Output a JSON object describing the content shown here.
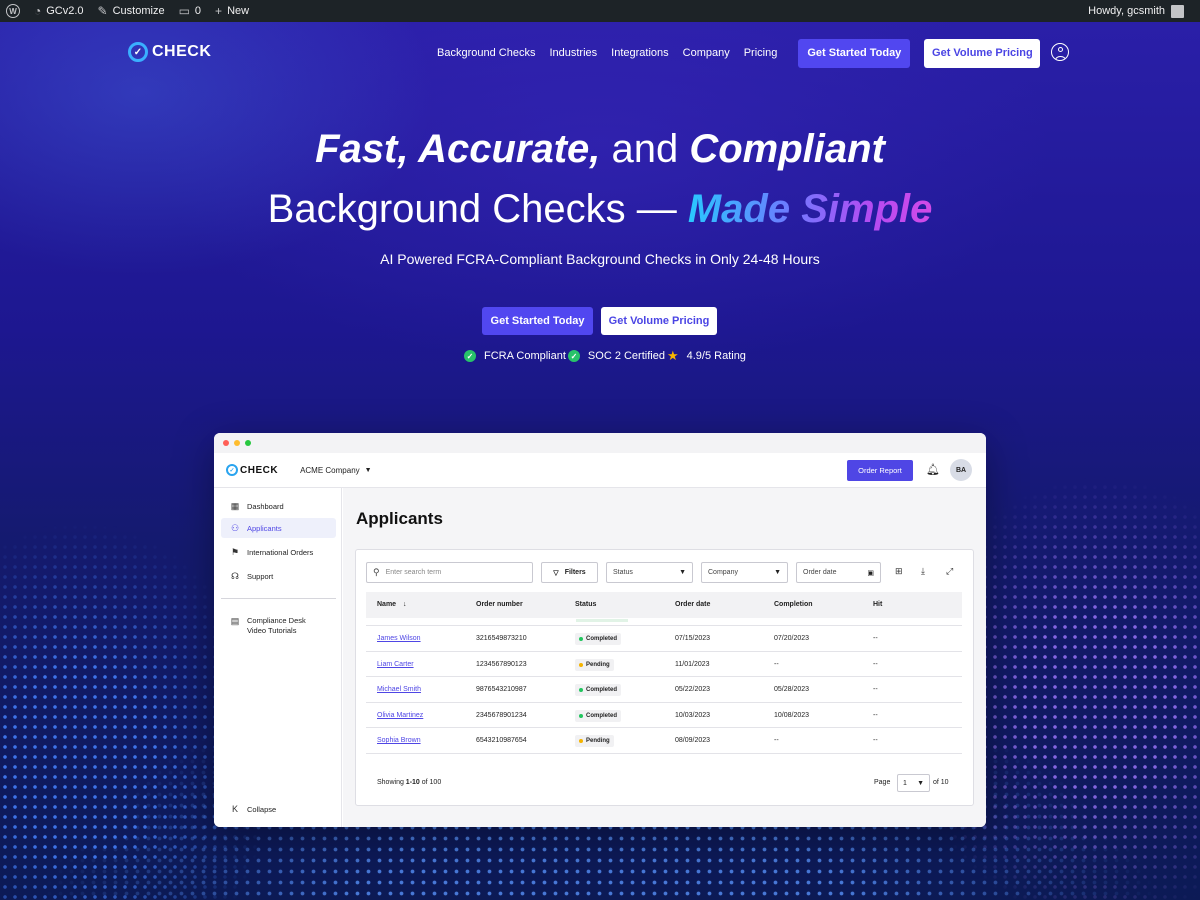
{
  "admin_bar": {
    "site_name": "GCv2.0",
    "customize": "Customize",
    "comments_count": "0",
    "new_label": "New",
    "greeting": "Howdy, gcsmith"
  },
  "brand": {
    "logo_text": "CHECK",
    "accent_color": "#5147f0",
    "logo_color": "#3ab0ff"
  },
  "nav": {
    "links": [
      "Background Checks",
      "Industries",
      "Integrations",
      "Company",
      "Pricing"
    ],
    "primary_cta": "Get Started Today",
    "secondary_cta": "Get Volume Pricing"
  },
  "hero": {
    "line1_a": "Fast, Accurate,",
    "line1_b": " and ",
    "line1_c": "Compliant",
    "line2_a": "Background Checks — ",
    "line2_b": "Made Simple",
    "subhead": "AI Powered FCRA-Compliant Background Checks in Only 24-48 Hours",
    "primary_cta": "Get Started Today",
    "secondary_cta": "Get Volume Pricing",
    "badges": [
      "FCRA Compliant",
      "SOC 2 Certified",
      "4.9/5 Rating"
    ]
  },
  "app": {
    "logo_text": "CHECK",
    "company_selector": "ACME Company",
    "order_button": "Order Report",
    "user_initials": "BA",
    "sidebar": {
      "items": [
        {
          "label": "Dashboard",
          "icon": "grid-icon"
        },
        {
          "label": "Applicants",
          "icon": "users-icon"
        },
        {
          "label": "International Orders",
          "icon": "flag-icon"
        },
        {
          "label": "Support",
          "icon": "headset-icon"
        }
      ],
      "compliance_label_1": "Compliance Desk",
      "compliance_label_2": "Video Tutorials",
      "collapse_label": "Collapse"
    },
    "page_title": "Applicants",
    "toolbar": {
      "search_placeholder": "Enter search term",
      "filters_label": "Filters",
      "status_select": "Status",
      "company_select": "Company",
      "order_date_select": "Order date"
    },
    "table": {
      "columns": [
        "Name",
        "Order number",
        "Status",
        "Order date",
        "Completion",
        "Hit"
      ],
      "rows": [
        {
          "name": "James Wilson",
          "order": "3216549873210",
          "status": "Completed",
          "order_date": "07/15/2023",
          "completion": "07/20/2023",
          "hit": "--"
        },
        {
          "name": "Liam Carter",
          "order": "1234567890123",
          "status": "Pending",
          "order_date": "11/01/2023",
          "completion": "--",
          "hit": "--"
        },
        {
          "name": "Michael Smith",
          "order": "9876543210987",
          "status": "Completed",
          "order_date": "05/22/2023",
          "completion": "05/28/2023",
          "hit": "--"
        },
        {
          "name": "Olivia Martinez",
          "order": "2345678901234",
          "status": "Completed",
          "order_date": "10/03/2023",
          "completion": "10/08/2023",
          "hit": "--"
        },
        {
          "name": "Sophia Brown",
          "order": "6543210987654",
          "status": "Pending",
          "order_date": "08/09/2023",
          "completion": "--",
          "hit": "--"
        }
      ]
    },
    "pagination": {
      "showing_prefix": "Showing ",
      "showing_range": "1-10",
      "showing_suffix": " of 100",
      "page_label": "Page",
      "page_value": "1",
      "of_total": "of 10"
    },
    "status_colors": {
      "Completed": "#22c55e",
      "Pending": "#f5b400"
    }
  }
}
